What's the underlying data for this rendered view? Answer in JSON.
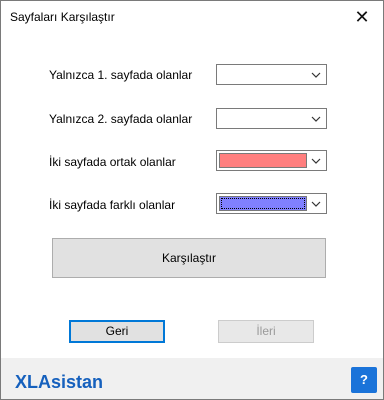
{
  "window": {
    "title": "Sayfaları Karşılaştır",
    "close_glyph": "✕"
  },
  "rows": [
    {
      "label": "Yalnızca 1. sayfada olanlar",
      "color": "#ffffff"
    },
    {
      "label": "Yalnızca 2. sayfada olanlar",
      "color": "#ffffff"
    },
    {
      "label": "İki sayfada ortak olanlar",
      "color": "#ff7f7f"
    },
    {
      "label": "İki sayfada farklı olanlar",
      "color": "#8080ff"
    }
  ],
  "compare_button": "Karşılaştır",
  "back_button": "Geri",
  "next_button": "İleri",
  "footer": {
    "brand": "XLAsistan",
    "help": "?"
  }
}
